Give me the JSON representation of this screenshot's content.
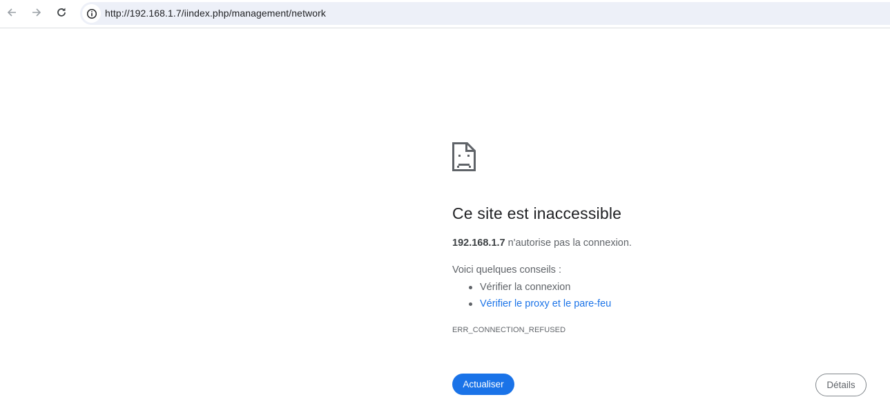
{
  "browser": {
    "back_icon": "arrow-left-icon",
    "forward_icon": "arrow-right-icon",
    "reload_icon": "reload-icon",
    "site_info_icon": "info-circle-icon",
    "url": "http://192.168.1.7/iindex.php/management/network",
    "omnibox_bg": "#edf0f8"
  },
  "error": {
    "icon": "sad-document-icon",
    "title": "Ce site est inaccessible",
    "host": "192.168.1.7",
    "message_suffix": " n'autorise pas la connexion.",
    "suggestions_heading": "Voici quelques conseils :",
    "suggestions": [
      {
        "label": "Vérifier la connexion",
        "is_link": false
      },
      {
        "label": "Vérifier le proxy et le pare-feu",
        "is_link": true
      }
    ],
    "code": "ERR_CONNECTION_REFUSED",
    "reload_label": "Actualiser",
    "details_label": "Détails"
  },
  "colors": {
    "accent": "#1a73e8",
    "text_primary": "#202124",
    "text_secondary": "#5f6368"
  }
}
